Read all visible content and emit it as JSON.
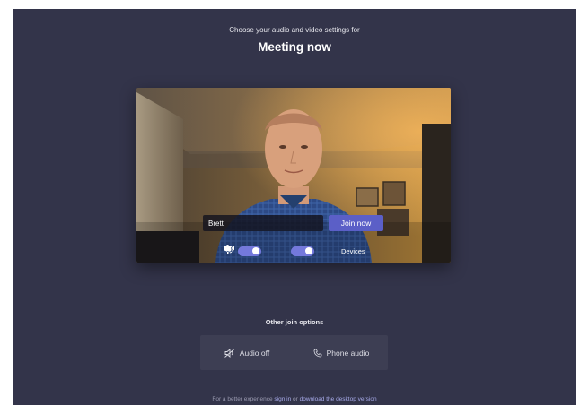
{
  "header": {
    "subtitle": "Choose your audio and video settings for",
    "title": "Meeting now"
  },
  "preview": {
    "name_value": "Brett",
    "join_label": "Join now",
    "camera_on": true,
    "mic_on": true,
    "devices_label": "Devices"
  },
  "other_options": {
    "label": "Other join options",
    "audio_off_label": "Audio off",
    "phone_audio_label": "Phone audio"
  },
  "footer": {
    "prefix": "For a better experience",
    "link1": "sign in",
    "middle": "or",
    "link2": "download the desktop version"
  },
  "colors": {
    "background": "#33344a",
    "accent": "#5b5fc7",
    "toggle": "#7479dc"
  }
}
